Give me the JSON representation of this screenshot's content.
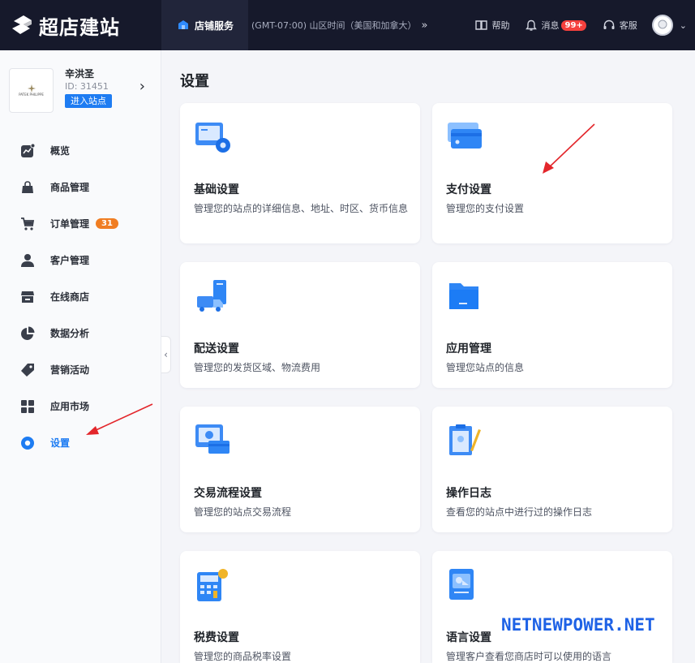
{
  "brand": {
    "name": "超店建站"
  },
  "topbar": {
    "store_service": "店铺服务",
    "timezone": "(GMT-07:00) 山区时间（美国和加拿大）",
    "help": "帮助",
    "messages": "消息",
    "messages_badge": "99+",
    "support": "客服"
  },
  "store": {
    "name": "辛洪圣",
    "id": "ID: 31451",
    "enter_label": "进入站点",
    "logo_text": "PATEK PHILIPPE"
  },
  "nav": {
    "items": [
      {
        "label": "概览",
        "icon": "overview-chart-icon"
      },
      {
        "label": "商品管理",
        "icon": "bag-icon"
      },
      {
        "label": "订单管理",
        "icon": "cart-icon",
        "badge": "31"
      },
      {
        "label": "客户管理",
        "icon": "user-icon"
      },
      {
        "label": "在线商店",
        "icon": "store-icon"
      },
      {
        "label": "数据分析",
        "icon": "pie-chart-icon"
      },
      {
        "label": "营销活动",
        "icon": "tag-icon"
      },
      {
        "label": "应用市场",
        "icon": "grid-apps-icon"
      },
      {
        "label": "设置",
        "icon": "settings-icon",
        "active": true
      }
    ]
  },
  "main": {
    "title": "设置",
    "cards": [
      {
        "title": "基础设置",
        "desc": "管理您的站点的详细信息、地址、时区、货币信息",
        "icon": "basic-settings-icon"
      },
      {
        "title": "支付设置",
        "desc": "管理您的支付设置",
        "icon": "payment-card-icon"
      },
      {
        "title": "配送设置",
        "desc": "管理您的发货区域、物流费用",
        "icon": "delivery-truck-icon"
      },
      {
        "title": "应用管理",
        "desc": "管理您站点的信息",
        "icon": "folder-icon"
      },
      {
        "title": "交易流程设置",
        "desc": "管理您的站点交易流程",
        "icon": "transaction-flow-icon"
      },
      {
        "title": "操作日志",
        "desc": "查看您的站点中进行过的操作日志",
        "icon": "clipboard-log-icon"
      },
      {
        "title": "税费设置",
        "desc": "管理您的商品税率设置",
        "icon": "calculator-icon"
      },
      {
        "title": "语言设置",
        "desc": "管理客户查看您商店时可以使用的语言",
        "icon": "language-icon"
      }
    ]
  },
  "watermark": "NETNEWPOWER.NET",
  "colors": {
    "topbar": "#16192b",
    "accent": "#1e7cf2",
    "badge_red": "#f5403d",
    "badge_orange": "#f07d22",
    "annotation_arrow": "#e3262b"
  }
}
